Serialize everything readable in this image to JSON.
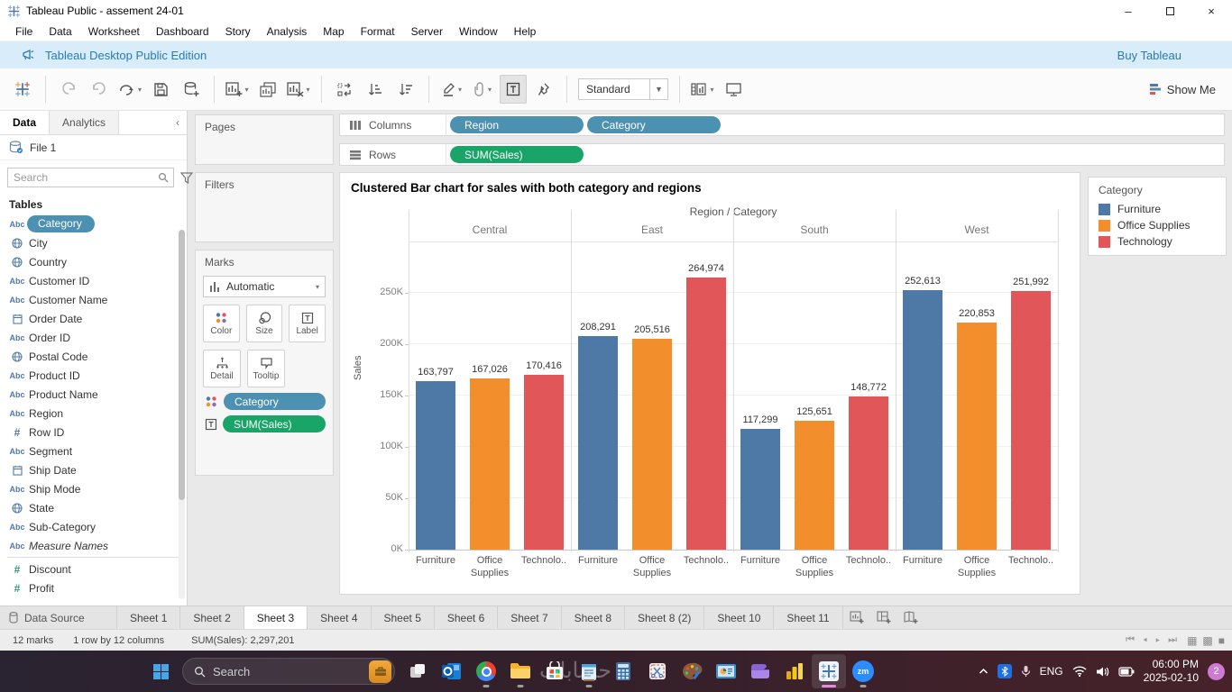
{
  "window": {
    "title": "Tableau Public - assement 24-01"
  },
  "menu": {
    "items": [
      "File",
      "Data",
      "Worksheet",
      "Dashboard",
      "Story",
      "Analysis",
      "Map",
      "Format",
      "Server",
      "Window",
      "Help"
    ]
  },
  "banner": {
    "edition": "Tableau Desktop Public Edition",
    "buy": "Buy Tableau"
  },
  "toolbar": {
    "view_mode": "Standard",
    "show_me": "Show Me"
  },
  "data_pane": {
    "tab_data": "Data",
    "tab_analytics": "Analytics",
    "connection": "File 1",
    "search_placeholder": "Search",
    "tables_header": "Tables",
    "fields": [
      {
        "name": "Category",
        "icon": "abc",
        "selected": true
      },
      {
        "name": "City",
        "icon": "globe"
      },
      {
        "name": "Country",
        "icon": "globe"
      },
      {
        "name": "Customer ID",
        "icon": "abc"
      },
      {
        "name": "Customer Name",
        "icon": "abc"
      },
      {
        "name": "Order Date",
        "icon": "calendar"
      },
      {
        "name": "Order ID",
        "icon": "abc"
      },
      {
        "name": "Postal Code",
        "icon": "globe"
      },
      {
        "name": "Product ID",
        "icon": "abc"
      },
      {
        "name": "Product Name",
        "icon": "abc"
      },
      {
        "name": "Region",
        "icon": "abc"
      },
      {
        "name": "Row ID",
        "icon": "num"
      },
      {
        "name": "Segment",
        "icon": "abc"
      },
      {
        "name": "Ship Date",
        "icon": "calendar"
      },
      {
        "name": "Ship Mode",
        "icon": "abc"
      },
      {
        "name": "State",
        "icon": "globe"
      },
      {
        "name": "Sub-Category",
        "icon": "abc"
      },
      {
        "name": "Measure Names",
        "icon": "abc",
        "italic": true
      },
      {
        "name": "Discount",
        "icon": "num-green",
        "divider_before": true
      },
      {
        "name": "Profit",
        "icon": "num-green"
      }
    ]
  },
  "cards": {
    "pages": "Pages",
    "filters": "Filters",
    "marks": "Marks",
    "mark_type": "Automatic",
    "buttons_row1": [
      "Color",
      "Size",
      "Label"
    ],
    "buttons_row2": [
      "Detail",
      "Tooltip"
    ],
    "pills": [
      {
        "label": "Category",
        "color_class": "pill-blue",
        "icon": "color-dots"
      },
      {
        "label": "SUM(Sales)",
        "color_class": "pill-green",
        "icon": "text-label"
      }
    ]
  },
  "shelves": {
    "columns_label": "Columns",
    "rows_label": "Rows",
    "columns_pills": [
      "Region",
      "Category"
    ],
    "rows_pills": [
      "SUM(Sales)"
    ]
  },
  "chart_data": {
    "type": "bar",
    "title": "Clustered Bar chart for sales with both category and regions",
    "col_header": "Region / Category",
    "regions": [
      "Central",
      "East",
      "South",
      "West"
    ],
    "categories": [
      "Furniture",
      "Office Supplies",
      "Technology"
    ],
    "category_axis_labels": [
      "Furniture",
      "Office\nSupplies",
      "Technolo.."
    ],
    "series": [
      {
        "region": "Central",
        "values": [
          163797,
          167026,
          170416
        ]
      },
      {
        "region": "East",
        "values": [
          208291,
          205516,
          264974
        ]
      },
      {
        "region": "South",
        "values": [
          117299,
          125651,
          148772
        ]
      },
      {
        "region": "West",
        "values": [
          252613,
          220853,
          251992
        ]
      }
    ],
    "value_labels": [
      [
        "163,797",
        "167,026",
        "170,416"
      ],
      [
        "208,291",
        "205,516",
        "264,974"
      ],
      [
        "117,299",
        "125,651",
        "148,772"
      ],
      [
        "252,613",
        "220,853",
        "251,992"
      ]
    ],
    "colors": {
      "Furniture": "#4e79a7",
      "Office Supplies": "#f28e2b",
      "Technology": "#e15759"
    },
    "ylabel": "Sales",
    "yticks": [
      "0K",
      "50K",
      "100K",
      "150K",
      "200K",
      "250K"
    ],
    "ytick_values": [
      0,
      50000,
      100000,
      150000,
      200000,
      250000
    ],
    "ylim": [
      0,
      300000
    ],
    "grid": true,
    "legend_position": "right"
  },
  "legend": {
    "title": "Category",
    "items": [
      {
        "label": "Furniture",
        "color": "#4e79a7"
      },
      {
        "label": "Office Supplies",
        "color": "#f28e2b"
      },
      {
        "label": "Technology",
        "color": "#e15759"
      }
    ]
  },
  "sheet_tabs": {
    "data_source": "Data Source",
    "tabs": [
      "Sheet 1",
      "Sheet 2",
      "Sheet 3",
      "Sheet 4",
      "Sheet 5",
      "Sheet 6",
      "Sheet 7",
      "Sheet 8",
      "Sheet 8 (2)",
      "Sheet 10",
      "Sheet 11"
    ],
    "active": "Sheet 3"
  },
  "status_bar": {
    "marks": "12 marks",
    "dimensions": "1 row by 12 columns",
    "aggregate": "SUM(Sales): 2,297,201"
  },
  "taskbar": {
    "search_placeholder": "Search",
    "watermark": "حسابات",
    "icons": [
      {
        "name": "task-view"
      },
      {
        "name": "outlook"
      },
      {
        "name": "chrome",
        "open": true
      },
      {
        "name": "file-explorer",
        "open": true
      },
      {
        "name": "microsoft-store"
      },
      {
        "name": "notepad",
        "open": true
      },
      {
        "name": "calculator"
      },
      {
        "name": "snipping-tool"
      },
      {
        "name": "paint"
      },
      {
        "name": "presentation-app"
      },
      {
        "name": "clipchamp"
      },
      {
        "name": "power-bi"
      },
      {
        "name": "tableau",
        "open": true,
        "active": true
      },
      {
        "name": "zoom",
        "open": true
      }
    ],
    "language": "ENG",
    "time": "06:00 PM",
    "date": "2025-02-10",
    "badge": "2"
  }
}
